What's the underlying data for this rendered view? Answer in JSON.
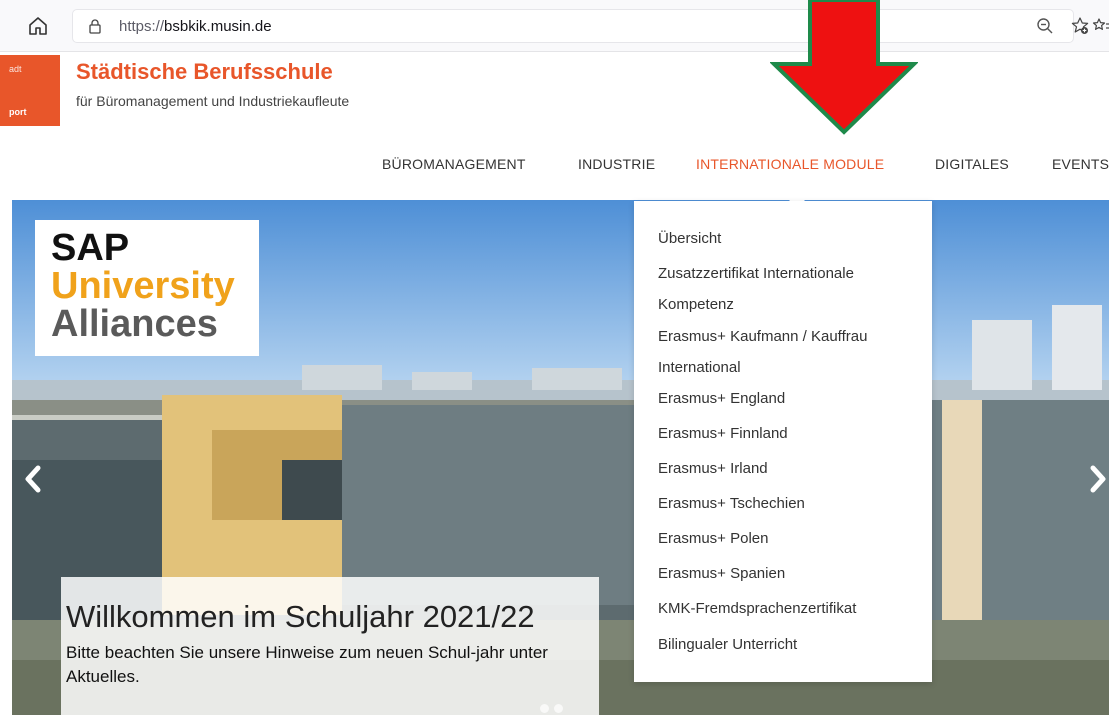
{
  "browser": {
    "url_scheme": "https://",
    "url_host": "bsbkik.musin.de"
  },
  "header": {
    "logo_line1": "adt",
    "logo_line2": "port",
    "title": "Städtische Berufsschule",
    "subtitle": "für Büromanagement und Industriekaufleute"
  },
  "nav": {
    "items": [
      {
        "label": "BÜROMANAGEMENT"
      },
      {
        "label": "INDUSTRIE"
      },
      {
        "label": "INTERNATIONALE MODULE"
      },
      {
        "label": "DIGITALES"
      },
      {
        "label": "EVENTS"
      }
    ],
    "active_color": "#e8562a"
  },
  "dropdown": {
    "items": [
      {
        "label": "Übersicht"
      },
      {
        "label": "Zusatzzertifikat Internationale Kompetenz"
      },
      {
        "label": "Erasmus+ Kaufmann / Kauffrau International"
      },
      {
        "label": "Erasmus+ England"
      },
      {
        "label": "Erasmus+ Finnland"
      },
      {
        "label": "Erasmus+ Irland"
      },
      {
        "label": "Erasmus+ Tschechien"
      },
      {
        "label": "Erasmus+ Polen"
      },
      {
        "label": "Erasmus+ Spanien"
      },
      {
        "label": "KMK-Fremdsprachenzertifikat"
      },
      {
        "label": "Bilingualer Unterricht"
      }
    ]
  },
  "hero": {
    "sap_line1": "SAP",
    "sap_line2": "University",
    "sap_line3": "Alliances",
    "caption_title": "Willkommen im Schuljahr 2021/22",
    "caption_text": "Bitte beachten Sie unsere Hinweise zum neuen Schul-jahr unter Aktuelles."
  },
  "colors": {
    "brand": "#e8562a",
    "annotation_arrow": "#ee1111",
    "annotation_border": "#1e8a4a"
  }
}
